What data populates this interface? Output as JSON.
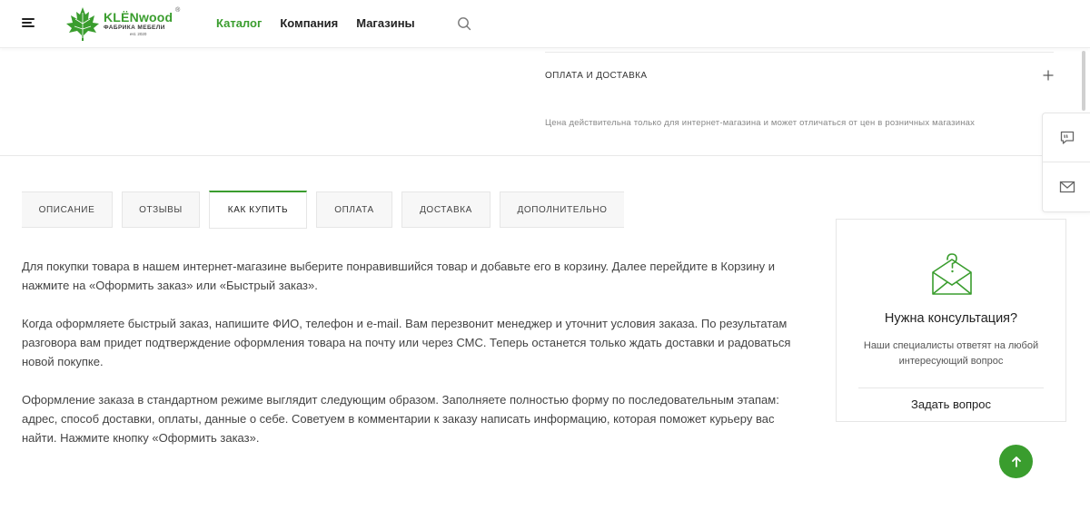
{
  "header": {
    "logo": {
      "brand": "KLЁNwood",
      "subtitle": "ФАБРИКА МЕБЕЛИ",
      "est": "est. 2020",
      "reg": "®"
    },
    "nav": [
      {
        "label": "Каталог",
        "active": true
      },
      {
        "label": "Компания",
        "active": false
      },
      {
        "label": "Магазины",
        "active": false
      }
    ],
    "search_icon": "search-icon"
  },
  "product": {
    "accordion_label": "ОПЛАТА И ДОСТАВКА",
    "price_note": "Цена действительна только для интернет-магазина и может отличаться от цен в розничных магазинах"
  },
  "tabs": [
    {
      "label": "ОПИСАНИЕ",
      "active": false
    },
    {
      "label": "ОТЗЫВЫ",
      "active": false
    },
    {
      "label": "КАК КУПИТЬ",
      "active": true
    },
    {
      "label": "ОПЛАТА",
      "active": false
    },
    {
      "label": "ДОСТАВКА",
      "active": false
    },
    {
      "label": "ДОПОЛНИТЕЛЬНО",
      "active": false
    }
  ],
  "content": {
    "paragraphs": [
      "Для покупки товара в нашем интернет-магазине выберите понравившийся товар и добавьте его в корзину. Далее перейдите в Корзину и нажмите на «Оформить заказ» или «Быстрый заказ».",
      "Когда оформляете быстрый заказ, напишите ФИО, телефон и e-mail. Вам перезвонит менеджер и уточнит условия заказа. По результатам разговора вам придет подтверждение оформления товара на почту или через СМС. Теперь останется только ждать доставки и радоваться новой покупке.",
      "Оформление заказа в стандартном режиме выглядит следующим образом. Заполняете полностью форму по последовательным этапам: адрес, способ доставки, оплаты, данные о себе. Советуем в комментарии к заказу написать информацию, которая поможет курьеру вас найти. Нажмите кнопку «Оформить заказ»."
    ]
  },
  "consult": {
    "title": "Нужна консультация?",
    "text": "Наши специалисты ответят на любой интересующий вопрос",
    "button": "Задать вопрос"
  },
  "colors": {
    "accent": "#3a9d2e",
    "text": "#444444",
    "border": "#e6e6e6"
  }
}
